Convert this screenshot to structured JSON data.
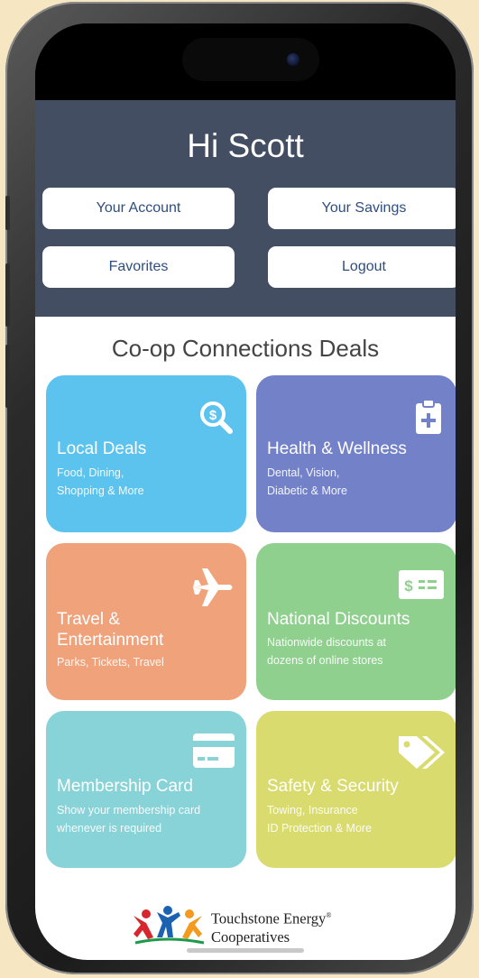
{
  "header": {
    "greeting": "Hi Scott",
    "buttons": {
      "your_account": "Your Account",
      "your_savings": "Your Savings",
      "favorites": "Favorites",
      "logout": "Logout"
    }
  },
  "section_title": "Co-op Connections Deals",
  "tiles": [
    {
      "title": "Local Deals",
      "subtitle_1": "Food, Dining,",
      "subtitle_2": "Shopping & More",
      "icon": "search-dollar-icon",
      "color": "#5bc3ee"
    },
    {
      "title": "Health & Wellness",
      "subtitle_1": "Dental, Vision,",
      "subtitle_2": "Diabetic & More",
      "icon": "clipboard-plus-icon",
      "color": "#7281c8"
    },
    {
      "title_1": "Travel &",
      "title_2": "Entertainment",
      "subtitle_1": "Parks, Tickets, Travel",
      "icon": "airplane-icon",
      "color": "#f0a27a"
    },
    {
      "title": "National Discounts",
      "subtitle_1": "Nationwide discounts at",
      "subtitle_2": "dozens of online stores",
      "icon": "dollar-bill-icon",
      "color": "#8fd08f"
    },
    {
      "title": "Membership Card",
      "subtitle_1": "Show your membership card",
      "subtitle_2": "whenever is required",
      "icon": "credit-card-icon",
      "color": "#88d3d8"
    },
    {
      "title": "Safety & Security",
      "subtitle_1": "Towing, Insurance",
      "subtitle_2": "ID Protection & More",
      "icon": "tag-icon",
      "color": "#d9db6e"
    }
  ],
  "logo": {
    "line_1": "Touchstone Energy",
    "registered": "®",
    "line_2": "Cooperatives"
  }
}
